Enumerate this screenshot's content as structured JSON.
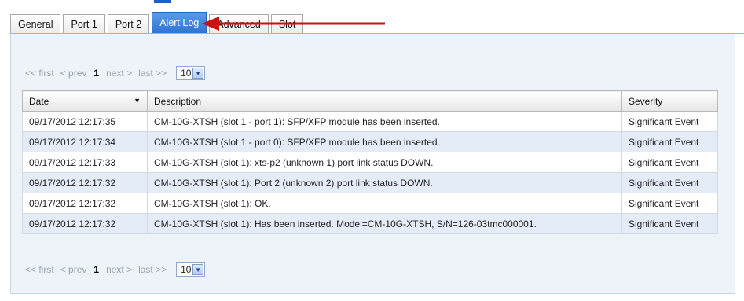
{
  "tabs": [
    {
      "label": "General",
      "active": false
    },
    {
      "label": "Port 1",
      "active": false
    },
    {
      "label": "Port 2",
      "active": false
    },
    {
      "label": "Alert Log",
      "active": true
    },
    {
      "label": "Advanced",
      "active": false
    },
    {
      "label": "Slot",
      "active": false
    }
  ],
  "pager": {
    "first": "<< first",
    "prev": "< prev",
    "current_page": "1",
    "next": "next >",
    "last": "last >>",
    "page_size": "10"
  },
  "table": {
    "columns": [
      "Date",
      "Description",
      "Severity"
    ],
    "rows": [
      [
        "09/17/2012 12:17:35",
        "CM-10G-XTSH (slot 1 - port 1): SFP/XFP module has been inserted.",
        "Significant Event"
      ],
      [
        "09/17/2012 12:17:34",
        "CM-10G-XTSH (slot 1 - port 0): SFP/XFP module has been inserted.",
        "Significant Event"
      ],
      [
        "09/17/2012 12:17:33",
        "CM-10G-XTSH (slot 1): xts-p2 (unknown 1) port link status DOWN.",
        "Significant Event"
      ],
      [
        "09/17/2012 12:17:32",
        "CM-10G-XTSH (slot 1): Port 2 (unknown 2) port link status DOWN.",
        "Significant Event"
      ],
      [
        "09/17/2012 12:17:32",
        "CM-10G-XTSH (slot 1): OK.",
        "Significant Event"
      ],
      [
        "09/17/2012 12:17:32",
        "CM-10G-XTSH (slot 1): Has been inserted. Model=CM-10G-XTSH, S/N=126-03tmc000001.",
        "Significant Event"
      ]
    ]
  },
  "colors": {
    "active_tab": "#2f74d6",
    "annotation_arrow": "#cc1111",
    "alt_row": "#e4ecf8"
  },
  "icons": {
    "sort": "sort-desc-icon",
    "select": "chevron-down-icon"
  }
}
